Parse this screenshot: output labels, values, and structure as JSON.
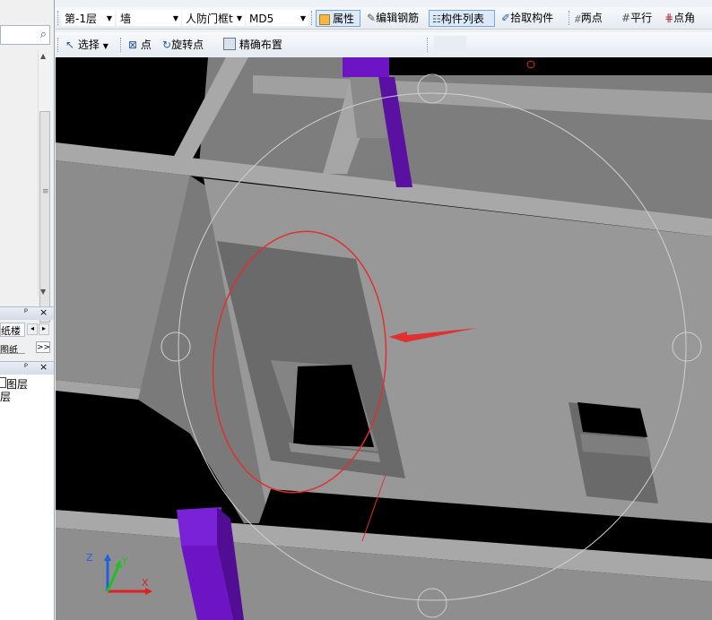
{
  "toolbar1": {
    "floor": "第-1层",
    "type": "墙",
    "component": "人防门框t",
    "code": "MD5",
    "buttons": [
      "属性",
      "编辑钢筋",
      "构件列表",
      "拾取构件",
      "两点",
      "平行",
      "点角"
    ]
  },
  "toolbar2": {
    "buttons": [
      "选择",
      "点",
      "旋转点",
      "精确布置"
    ]
  },
  "left_panel": {
    "tab_label": "纸楼",
    "tab_label2": "图纸",
    "layer_text": "图层",
    "layer_text2": "层",
    "panel1_pin": "⊕",
    "panel1_close": "×",
    "expand": ">>"
  },
  "axes": {
    "x": "X",
    "y": "Y",
    "z": "Z"
  },
  "colors": {
    "wall": "#9a9a9a",
    "column": "#6d15c4",
    "highlight": "#e03030"
  }
}
